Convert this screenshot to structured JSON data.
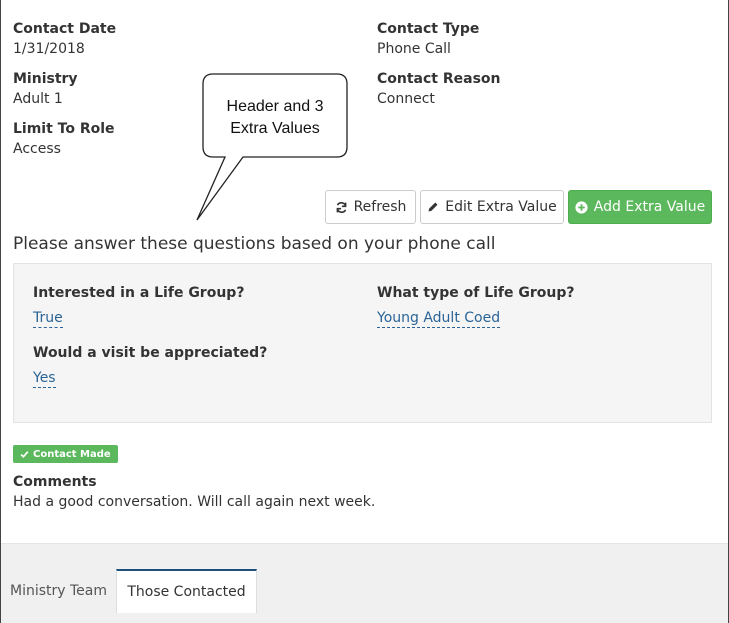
{
  "details": {
    "contact_date_label": "Contact Date",
    "contact_date_value": "1/31/2018",
    "ministry_label": "Ministry",
    "ministry_value": "Adult 1",
    "limit_role_label": "Limit To Role",
    "limit_role_value": "Access",
    "contact_type_label": "Contact Type",
    "contact_type_value": "Phone Call",
    "contact_reason_label": "Contact Reason",
    "contact_reason_value": "Connect"
  },
  "callout": {
    "line1": "Header and 3",
    "line2": "Extra Values"
  },
  "toolbar": {
    "refresh_label": "Refresh",
    "refresh_icon": "refresh-icon",
    "edit_label": "Edit Extra Value",
    "edit_icon": "pencil-icon",
    "add_label": "Add Extra Value",
    "add_icon": "plus-circle-icon"
  },
  "extra_values": {
    "header": "Please answer these questions based on your phone call",
    "items": [
      {
        "question": "Interested in a Life Group?",
        "answer": "True"
      },
      {
        "question": "What type of Life Group?",
        "answer": "Young Adult Coed"
      },
      {
        "question": "Would a visit be appreciated?",
        "answer": "Yes"
      }
    ]
  },
  "status": {
    "badge_label": "Contact Made",
    "badge_icon": "check-icon",
    "badge_color": "#5cb85c"
  },
  "comments": {
    "label": "Comments",
    "text": "Had a good conversation. Will call again next week."
  },
  "tabs": [
    {
      "label": "Ministry Team",
      "active": false
    },
    {
      "label": "Those Contacted",
      "active": true
    }
  ],
  "colors": {
    "accent_green": "#5cb85c",
    "link_blue": "#2a6496",
    "tab_active_border": "#1e4f7a"
  }
}
